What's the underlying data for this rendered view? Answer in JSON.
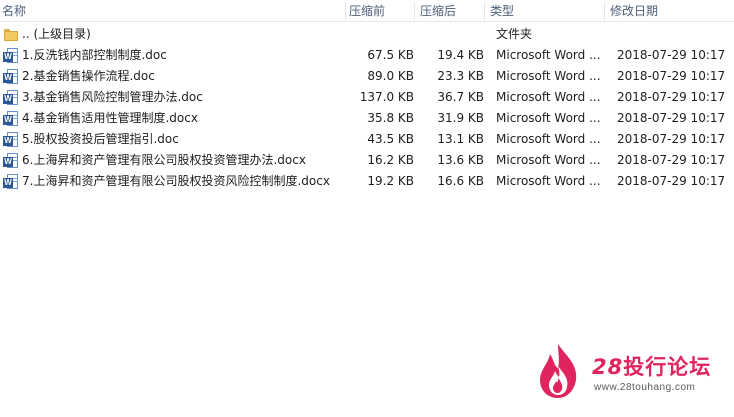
{
  "columns": {
    "name": "名称",
    "compressed": "压缩前",
    "original": "压缩后",
    "type": "类型",
    "modified": "修改日期"
  },
  "parent_row": {
    "name": ".. (上级目录)",
    "type": "文件夹",
    "icon": "folder-icon"
  },
  "files": [
    {
      "name": "1.反洗钱内部控制制度.doc",
      "compressed": "67.5 KB",
      "original": "19.4 KB",
      "type": "Microsoft Word ...",
      "modified": "2018-07-29 10:17",
      "icon": "word-doc-icon"
    },
    {
      "name": "2.基金销售操作流程.doc",
      "compressed": "89.0 KB",
      "original": "23.3 KB",
      "type": "Microsoft Word ...",
      "modified": "2018-07-29 10:17",
      "icon": "word-doc-icon"
    },
    {
      "name": "3.基金销售风险控制管理办法.doc",
      "compressed": "137.0 KB",
      "original": "36.7 KB",
      "type": "Microsoft Word ...",
      "modified": "2018-07-29 10:17",
      "icon": "word-doc-icon"
    },
    {
      "name": "4.基金销售适用性管理制度.docx",
      "compressed": "35.8 KB",
      "original": "31.9 KB",
      "type": "Microsoft Word ...",
      "modified": "2018-07-29 10:17",
      "icon": "word-docx-icon"
    },
    {
      "name": "5.股权投资投后管理指引.doc",
      "compressed": "43.5 KB",
      "original": "13.1 KB",
      "type": "Microsoft Word ...",
      "modified": "2018-07-29 10:17",
      "icon": "word-doc-icon"
    },
    {
      "name": "6.上海昇和资产管理有限公司股权投资管理办法.docx",
      "compressed": "16.2 KB",
      "original": "13.6 KB",
      "type": "Microsoft Word ...",
      "modified": "2018-07-29 10:17",
      "icon": "word-docx-icon"
    },
    {
      "name": "7.上海昇和资产管理有限公司股权投资风险控制制度.docx",
      "compressed": "19.2 KB",
      "original": "16.6 KB",
      "type": "Microsoft Word ...",
      "modified": "2018-07-29 10:17",
      "icon": "word-docx-icon"
    }
  ],
  "watermark": {
    "brand_num": "28",
    "brand_text": "投行论坛",
    "url": "www.28touhang.com",
    "color": "#e0245e"
  },
  "colors": {
    "header_text": "#4c607a",
    "word_blue": "#2b5797",
    "folder_yellow": "#f1cb62"
  }
}
